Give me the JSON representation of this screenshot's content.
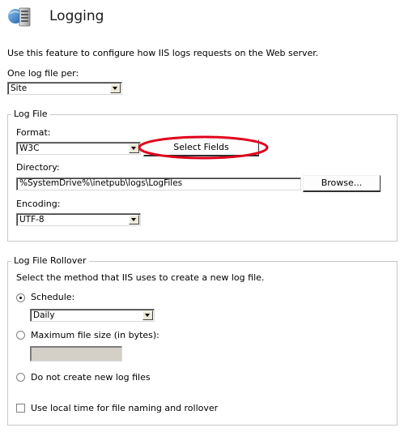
{
  "header": {
    "title": "Logging",
    "description": "Use this feature to configure how IIS logs requests on the Web server."
  },
  "log_file_per": {
    "label": "One log file per:",
    "value": "Site"
  },
  "log_file": {
    "legend": "Log File",
    "format_label": "Format:",
    "format_value": "W3C",
    "select_fields_label": "Select Fields",
    "directory_label": "Directory:",
    "directory_value": "%SystemDrive%\\inetpub\\logs\\LogFiles",
    "browse_label": "Browse...",
    "encoding_label": "Encoding:",
    "encoding_value": "UTF-8"
  },
  "rollover": {
    "legend": "Log File Rollover",
    "description": "Select the method that IIS uses to create a new log file.",
    "schedule_label": "Schedule:",
    "schedule_value": "Daily",
    "max_size_label": "Maximum file size (in bytes):",
    "max_size_value": "",
    "no_new_label": "Do not create new log files",
    "selected": "schedule"
  },
  "local_time": {
    "label": "Use local time for file naming and rollover",
    "checked": false
  },
  "colors": {
    "highlight_ring": "#e0001b",
    "group_border": "#c8c8c8"
  },
  "icons": {
    "header": "server-monitor-icon"
  }
}
